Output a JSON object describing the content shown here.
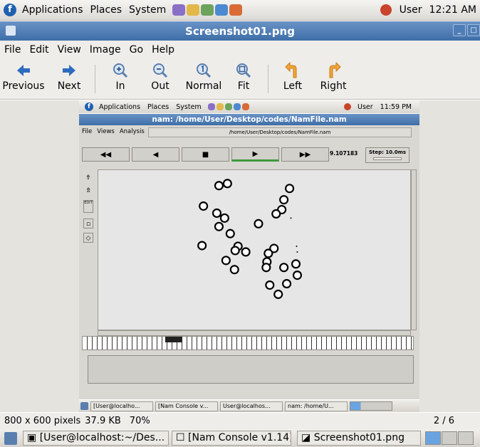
{
  "desktop_panel": {
    "menus": [
      "Applications",
      "Places",
      "System"
    ],
    "user": "User",
    "time": "12:21 AM",
    "launchers": [
      "#8a6fc7",
      "#e2b84a",
      "#6da35d",
      "#4b8ad1",
      "#d86b36"
    ]
  },
  "window": {
    "title": "Screenshot01.png"
  },
  "menubar": [
    {
      "label": "File"
    },
    {
      "label": "Edit"
    },
    {
      "label": "View"
    },
    {
      "label": "Image"
    },
    {
      "label": "Go"
    },
    {
      "label": "Help"
    }
  ],
  "toolbar": {
    "previous": "Previous",
    "next": "Next",
    "in": "In",
    "out": "Out",
    "normal": "Normal",
    "fit": "Fit",
    "left": "Left",
    "right": "Right"
  },
  "screenshot": {
    "panel_menus": [
      "Applications",
      "Places",
      "System"
    ],
    "panel_user": "User",
    "panel_time": "11:59 PM",
    "title": "nam: /home/User/Desktop/codes/NamFile.nam",
    "nam_menu": [
      "File",
      "Views",
      "Analysis"
    ],
    "path": "/home/User/Desktop/codes/NamFile.nam",
    "controls": [
      "◀◀",
      "◀",
      "■",
      "▶",
      "▶▶"
    ],
    "sim_time": "9.107183",
    "step": "Step: 10.0ms",
    "tools": [
      "EDIT"
    ],
    "taskbar": [
      "[User@localho...",
      "[Nam Console v...",
      "User@localhos...",
      "nam: /home/U..."
    ]
  },
  "status": {
    "dims": "800 x 600 pixels",
    "size": "37.9 KB",
    "zoom": "70%",
    "page": "2 / 6"
  },
  "taskbar": {
    "items": [
      "[User@localhost:~/Des...",
      "[Nam Console v1.14]",
      "Screenshot01.png"
    ]
  }
}
